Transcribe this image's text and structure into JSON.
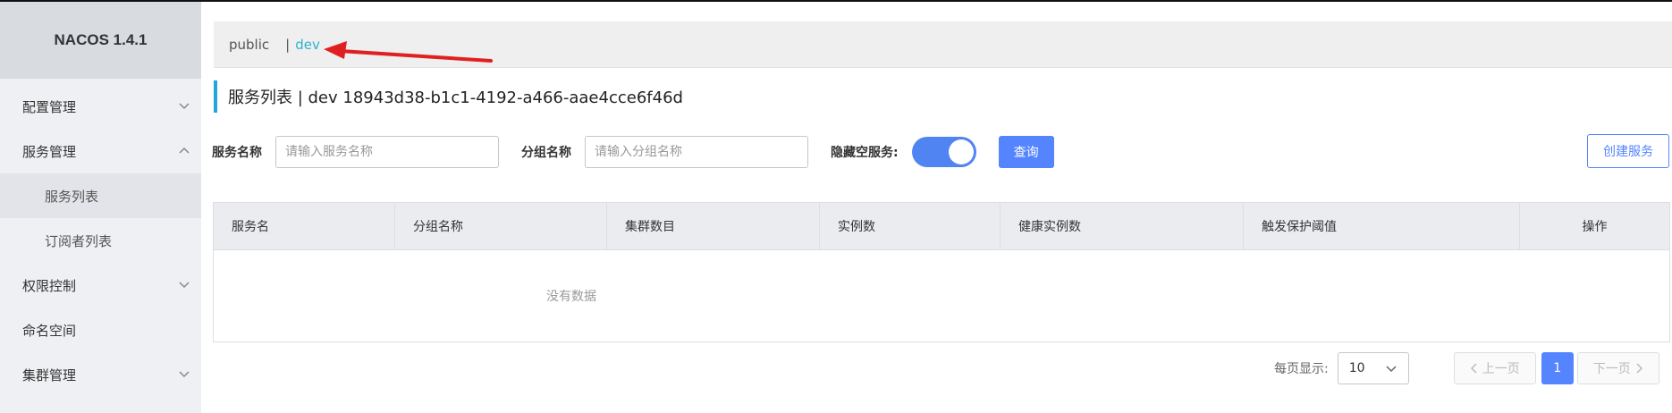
{
  "app": {
    "brand": "NACOS 1.4.1"
  },
  "sidebar": {
    "items": [
      {
        "label": "配置管理",
        "chevron": "down"
      },
      {
        "label": "服务管理",
        "chevron": "up"
      },
      {
        "label": "服务列表"
      },
      {
        "label": "订阅者列表"
      },
      {
        "label": "权限控制",
        "chevron": "down"
      },
      {
        "label": "命名空间"
      },
      {
        "label": "集群管理",
        "chevron": "down"
      }
    ]
  },
  "namespace_bar": {
    "public": "public",
    "separator": "|",
    "dev": "dev"
  },
  "page": {
    "title": "服务列表  |  dev  18943d38-b1c1-4192-a466-aae4cce6f46d"
  },
  "filters": {
    "service_name_label": "服务名称",
    "service_name_placeholder": "请输入服务名称",
    "group_name_label": "分组名称",
    "group_name_placeholder": "请输入分组名称",
    "hide_empty_label": "隐藏空服务:",
    "hide_empty_on": true,
    "query_button": "查询",
    "create_button": "创建服务"
  },
  "table": {
    "columns": [
      "服务名",
      "分组名称",
      "集群数目",
      "实例数",
      "健康实例数",
      "触发保护阈值",
      "操作"
    ],
    "empty_text": "没有数据"
  },
  "pagination": {
    "per_page_label": "每页显示:",
    "per_page_value": "10",
    "prev_label": "上一页",
    "current_page": "1",
    "next_label": "下一页"
  },
  "colors": {
    "accent": "#5584ff",
    "namespace_active": "#2eb2cc",
    "annotation_arrow": "#e02020"
  }
}
